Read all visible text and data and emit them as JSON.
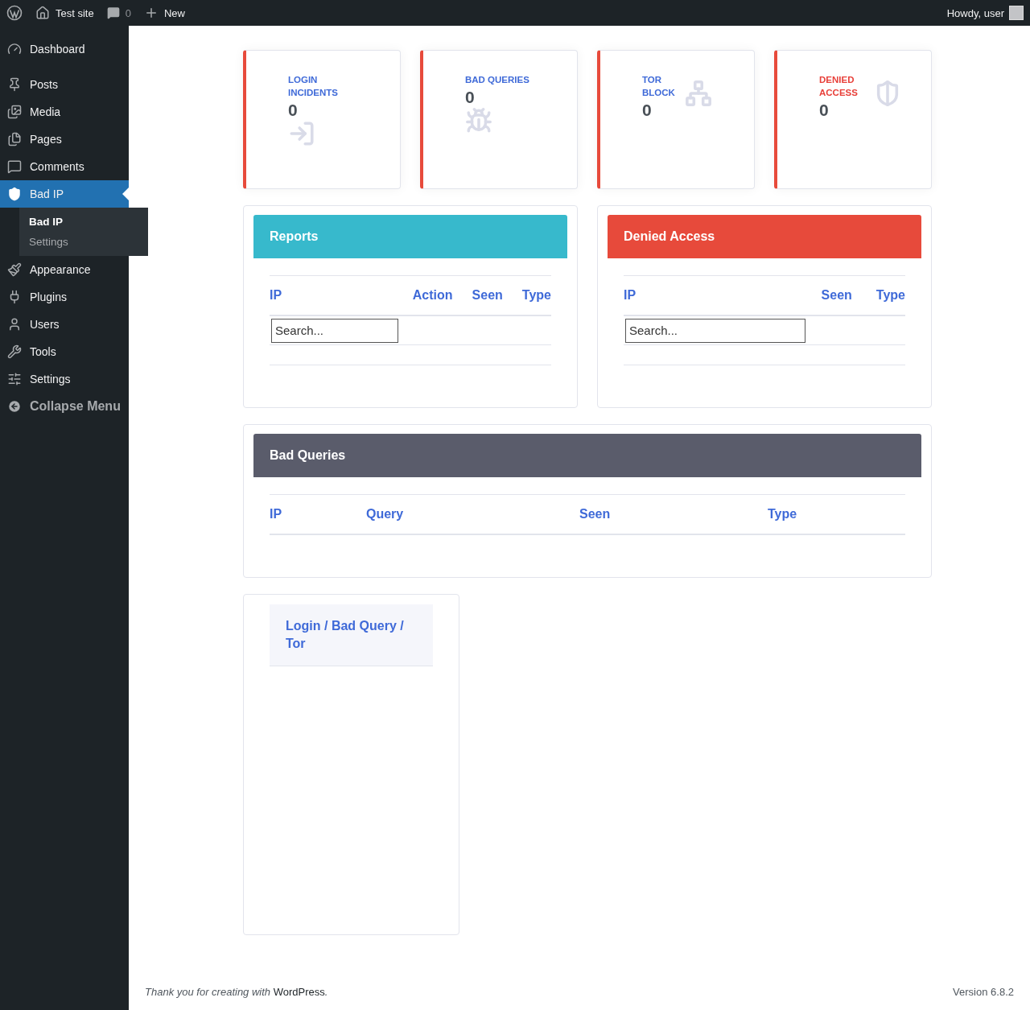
{
  "admin_bar": {
    "site": "Test site",
    "comments": "0",
    "new": "New",
    "greeting": "Howdy, user"
  },
  "sidebar": {
    "items": [
      {
        "label": "Dashboard",
        "selected": false
      },
      {
        "label": "Posts",
        "selected": false
      },
      {
        "label": "Media",
        "selected": false
      },
      {
        "label": "Pages",
        "selected": false
      },
      {
        "label": "Comments",
        "selected": false
      },
      {
        "label": "Bad IP",
        "selected": true,
        "children": [
          {
            "label": "Bad IP",
            "selected": true
          },
          {
            "label": "Settings",
            "selected": false
          }
        ]
      },
      {
        "label": "Appearance",
        "selected": false
      },
      {
        "label": "Plugins",
        "selected": false
      },
      {
        "label": "Users",
        "selected": false
      },
      {
        "label": "Tools",
        "selected": false
      },
      {
        "label": "Settings",
        "selected": false
      }
    ],
    "collapse": "Collapse Menu"
  },
  "stats": [
    {
      "label": "LOGIN INCIDENTS",
      "value": "0",
      "color": "#3f6ad8"
    },
    {
      "label": "BAD QUERIES",
      "value": "0",
      "color": "#3f6ad8"
    },
    {
      "label": "TOR BLOCK",
      "value": "0",
      "color": "#3f6ad8"
    },
    {
      "label": "DENIED ACCESS",
      "value": "0",
      "color": "#e8403a"
    }
  ],
  "panels": [
    {
      "title": "Reports",
      "color": "#37b9cc",
      "columns": [
        "IP",
        "Action",
        "Seen",
        "Type"
      ],
      "search": {
        "placeholder": "Search..."
      }
    },
    {
      "title": "Denied Access",
      "color": "#e74a3b",
      "columns": [
        "IP",
        "Seen",
        "Type"
      ],
      "search": {
        "placeholder": "Search..."
      }
    }
  ],
  "bad_queries": {
    "title": "Bad Queries",
    "columns": [
      "IP",
      "Query",
      "Seen",
      "Type"
    ]
  },
  "legend": {
    "title": "Login / Bad Query / Tor"
  },
  "footer": {
    "text": "Thank you for creating with",
    "link": "WordPress",
    "end": ".",
    "version": "Version 6.8.2"
  }
}
